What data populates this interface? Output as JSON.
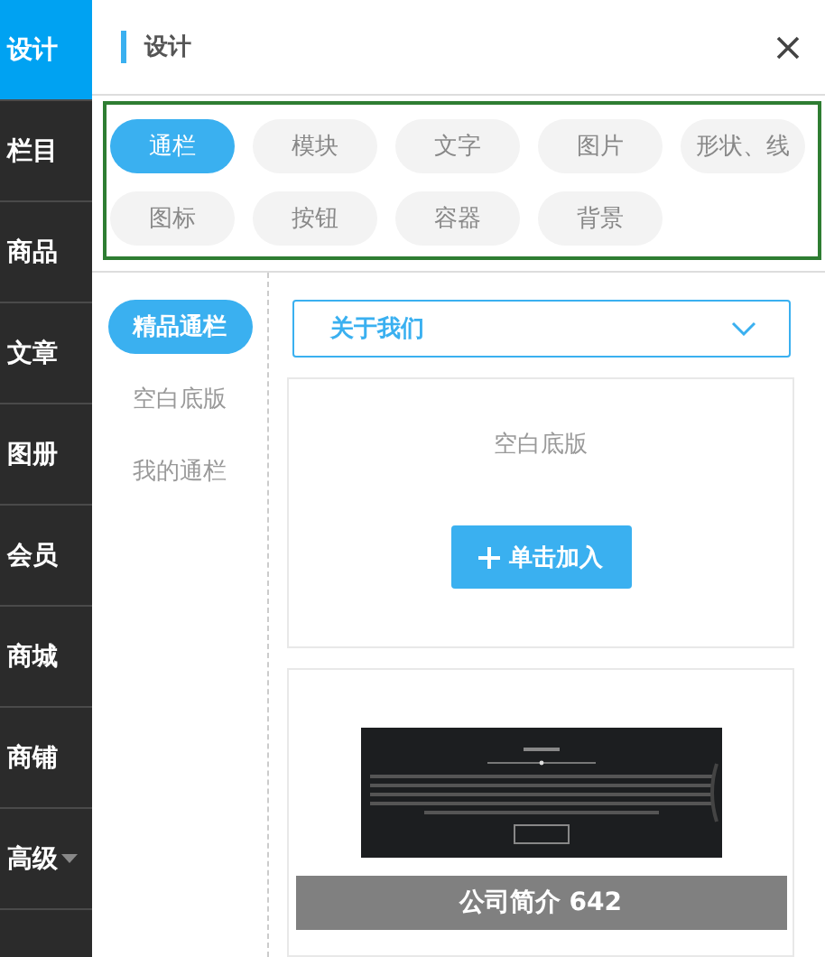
{
  "sidebar": {
    "items": [
      {
        "label": "设计",
        "selected": true,
        "caret": false
      },
      {
        "label": "栏目",
        "selected": false,
        "caret": false
      },
      {
        "label": "商品",
        "selected": false,
        "caret": false
      },
      {
        "label": "文章",
        "selected": false,
        "caret": false
      },
      {
        "label": "图册",
        "selected": false,
        "caret": false
      },
      {
        "label": "会员",
        "selected": false,
        "caret": false
      },
      {
        "label": "商城",
        "selected": false,
        "caret": false
      },
      {
        "label": "商铺",
        "selected": false,
        "caret": false
      },
      {
        "label": "高级",
        "selected": false,
        "caret": true
      }
    ]
  },
  "panel": {
    "title": "设计",
    "categories": [
      {
        "label": "通栏",
        "selected": true
      },
      {
        "label": "模块",
        "selected": false
      },
      {
        "label": "文字",
        "selected": false
      },
      {
        "label": "图片",
        "selected": false
      },
      {
        "label": "形状、线",
        "selected": false
      },
      {
        "label": "图标",
        "selected": false
      },
      {
        "label": "按钮",
        "selected": false
      },
      {
        "label": "容器",
        "selected": false
      },
      {
        "label": "背景",
        "selected": false
      }
    ],
    "subnav": [
      {
        "label": "精品通栏",
        "selected": true
      },
      {
        "label": "空白底版",
        "selected": false
      },
      {
        "label": "我的通栏",
        "selected": false
      }
    ],
    "dropdown": {
      "value": "关于我们"
    },
    "cards": [
      {
        "kind": "blank",
        "title": "空白底版",
        "button": "单击加入"
      },
      {
        "kind": "template",
        "caption": "公司简介 642"
      }
    ]
  }
}
